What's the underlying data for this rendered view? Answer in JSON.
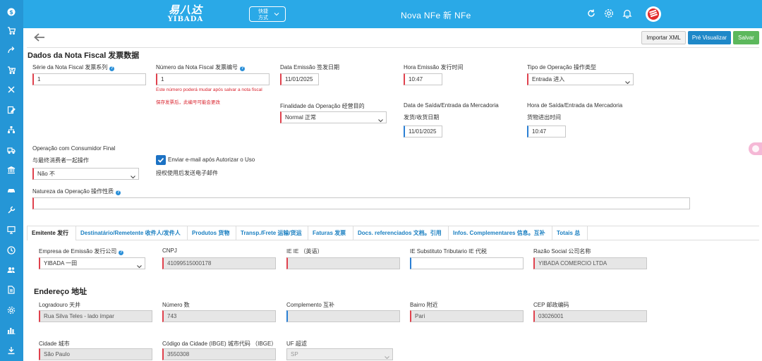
{
  "topbar": {
    "brand_cn": "易八达",
    "brand_en": "YIBADA",
    "shortcut_label_1": "快捷",
    "shortcut_label_2": "方式",
    "title": "Nova NFe  新 NFe",
    "icons": [
      "refresh-icon",
      "settings-icon",
      "bell-icon",
      "yibada-logo"
    ]
  },
  "sidebar": {
    "icons": [
      "dollar-icon",
      "cart-icon",
      "share-icon",
      "cart-check-icon",
      "tools-icon",
      "edit-doc-icon",
      "network-icon",
      "truck-icon",
      "bank-icon",
      "car-icon",
      "wrench-icon",
      "monitor-icon",
      "clock-icon",
      "users-icon",
      "document-icon",
      "gear-icon",
      "bar-chart-icon",
      "download-icon"
    ]
  },
  "actions": {
    "import_xml": "Importar XML",
    "preview": "Pré Visualizar",
    "save": "Salvar"
  },
  "dados": {
    "title": "Dados da Nota Fiscal  发票数据",
    "serie_label": "Série da Nota Fiscal  发票系列",
    "serie_value": "1",
    "numero_label": "Número da Nota Fiscal  发票编号",
    "numero_value": "1",
    "numero_note_pt": "Este número poderá mudar após salvar a nota fiscal",
    "numero_note_cn": "保存发票后，此编号可能会更改",
    "emissao_label": "Data Emissão  签发日期",
    "emissao_value": "11/01/2025",
    "hora_emissao_label": "Hora Emissão  发行时间",
    "hora_emissao_value": "10:47",
    "tipo_op_label": "Tipo de Operação  操作类型",
    "tipo_op_value": "Entrada  进入",
    "finalidade_label": "Finalidade da Operação  经营目的",
    "finalidade_value": "Normal  正常",
    "data_saida_label_pt": "Data de Saída/Entrada da Mercadoria",
    "data_saida_label_cn": "发货/收货日期",
    "data_saida_value": "11/01/2025",
    "hora_saida_label_pt": "Hora de Saída/Entrada da Mercadoria",
    "hora_saida_label_cn": "货物进出时间",
    "hora_saida_value": "10:47",
    "consumidor_label_pt": "Operação com Consumidor Final",
    "consumidor_label_cn": "与最终消费者一起操作",
    "consumidor_value": "Não  不",
    "email_label_pt": "Enviar e-mail após Autorizar o Uso",
    "email_label_cn": "授权使用后发送电子邮件",
    "natureza_label": "Natureza da Operação  操作性质",
    "natureza_value": ""
  },
  "tabs": [
    {
      "label": "Emitente  发行"
    },
    {
      "label": "Destinatário/Remetente  收件人/发件人"
    },
    {
      "label": "Produtos  货物"
    },
    {
      "label": "Transp./Frete  运输/货运"
    },
    {
      "label": "Faturas  发票"
    },
    {
      "label": "Docs. referenciados  文档。引用"
    },
    {
      "label": "Infos. Complementares  信息。互补"
    },
    {
      "label": "Totais  总"
    }
  ],
  "emitente": {
    "empresa_label": "Empresa de Emissão  发行公司",
    "empresa_value": "YIBADA  一田",
    "cnpj_label": "CNPJ",
    "cnpj_value": "41099515000178",
    "ie_label": "IE  IE （英语）",
    "ie_value": "",
    "ie_st_label": "IE Substituto Tributario  IE 代税",
    "ie_st_value": "",
    "razao_label": "Razão Social  公司名称",
    "razao_value": "YIBADA COMERCIO LTDA"
  },
  "endereco": {
    "title": "Endereço  地址",
    "logradouro_label": "Logradouro  天井",
    "logradouro_value": "Rua Silva Teles - lado ímpar",
    "numero_label": "Número  数",
    "numero_value": "743",
    "complemento_label": "Complemento  互补",
    "complemento_value": "",
    "bairro_label": "Bairro  附近",
    "bairro_value": "Pari",
    "cep_label": "CEP  邮政编码",
    "cep_value": "03026001",
    "cidade_label": "Cidade  城市",
    "cidade_value": "São Paulo",
    "ibge_label": "Código da Cidade (IBGE)  城市代码 （IBGE）",
    "ibge_value": "3550308",
    "uf_label": "UF  超滤",
    "uf_value": "SP"
  }
}
